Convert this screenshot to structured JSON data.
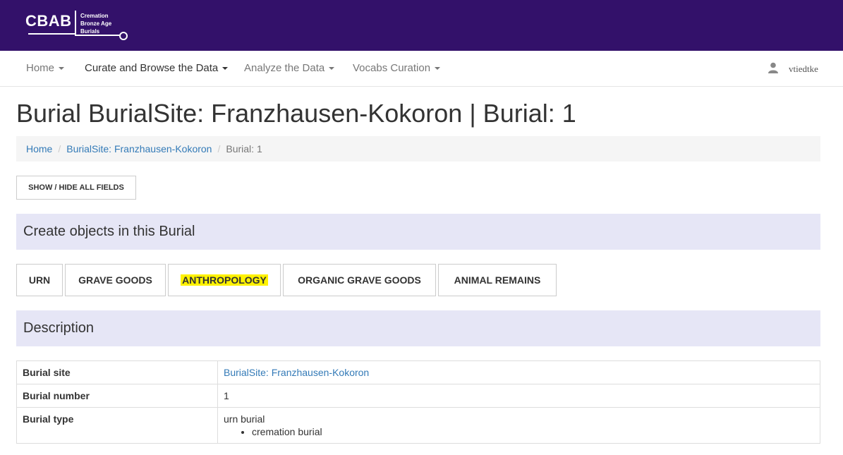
{
  "brand": {
    "logo_text": "CBAB",
    "logo_sub": [
      "Cremation",
      "Bronze Age",
      "Burials"
    ],
    "bg_color": "#33116a"
  },
  "nav": {
    "items": [
      {
        "label": "Home",
        "active": false
      },
      {
        "label": "Curate and Browse the Data",
        "active": true
      },
      {
        "label": "Analyze the Data",
        "active": false
      },
      {
        "label": "Vocabs Curation",
        "active": false
      }
    ],
    "user_icon": "user-icon",
    "username": "vtiedtke"
  },
  "page": {
    "title": "Burial BurialSite: Franzhausen-Kokoron | Burial: 1"
  },
  "breadcrumb": {
    "home": "Home",
    "site": "BurialSite: Franzhausen-Kokoron",
    "current": "Burial: 1",
    "separator": "/"
  },
  "toggle_button": "SHOW / HIDE ALL FIELDS",
  "create_section": {
    "title": "Create objects in this Burial",
    "buttons": [
      "URN",
      "GRAVE GOODS",
      "ANTHROPOLOGY",
      "ORGANIC GRAVE GOODS",
      "ANIMAL REMAINS"
    ],
    "highlight_color": "#fff200"
  },
  "description": {
    "title": "Description",
    "bg_color": "#e6e6f6",
    "rows": [
      {
        "label": "Burial site",
        "value": "BurialSite: Franzhausen-Kokoron"
      },
      {
        "label": "Burial number",
        "value": "1"
      },
      {
        "label": "Burial type",
        "value": "urn burial",
        "sub": "cremation burial"
      }
    ]
  },
  "colors": {
    "link": "#337ab7"
  }
}
